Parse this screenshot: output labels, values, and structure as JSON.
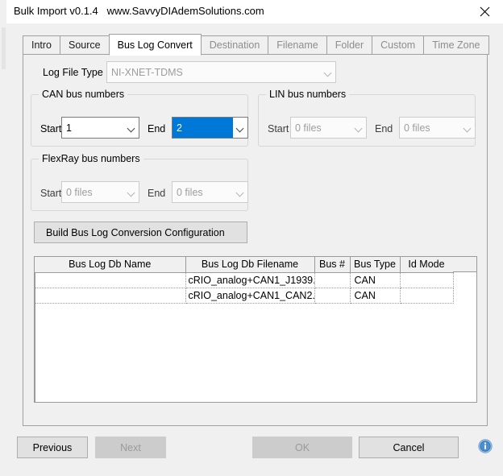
{
  "window": {
    "title": "Bulk Import v0.1.4   www.SavvyDIAdemSolutions.com",
    "close_icon": "close-icon"
  },
  "tabs": [
    {
      "label": "Intro",
      "state": "enabled"
    },
    {
      "label": "Source",
      "state": "enabled"
    },
    {
      "label": "Bus Log Convert",
      "state": "active"
    },
    {
      "label": "Destination",
      "state": "disabled"
    },
    {
      "label": "Filename",
      "state": "disabled"
    },
    {
      "label": "Folder",
      "state": "disabled"
    },
    {
      "label": "Custom",
      "state": "disabled"
    },
    {
      "label": "Time Zone",
      "state": "disabled"
    }
  ],
  "form": {
    "log_file_type_label": "Log File Type",
    "log_file_type_value": "NI-XNET-TDMS",
    "start_label": "Start",
    "end_label": "End",
    "can_group": {
      "title": "CAN bus numbers",
      "start_value": "1",
      "end_value": "2"
    },
    "lin_group": {
      "title": "LIN bus numbers",
      "start_value": "0 files",
      "end_value": "0 files"
    },
    "flexray_group": {
      "title": "FlexRay bus numbers",
      "start_value": "0 files",
      "end_value": "0 files"
    },
    "build_button_label": "Build Bus Log Conversion Configuration"
  },
  "grid": {
    "columns": [
      "Bus Log Db Name",
      "Bus Log Db Filename",
      "Bus #",
      "Bus Type",
      "Id Mode"
    ],
    "rows": [
      {
        "bus_log_db_name": "",
        "bus_log_db_filename": "cRIO_analog+CAN1_J1939....",
        "bus_number": "",
        "bus_type": "CAN",
        "id_mode": ""
      },
      {
        "bus_log_db_name": "",
        "bus_log_db_filename": "cRIO_analog+CAN1_CAN2...",
        "bus_number": "",
        "bus_type": "CAN",
        "id_mode": ""
      }
    ]
  },
  "footer": {
    "previous_label": "Previous",
    "next_label": "Next",
    "ok_label": "OK",
    "cancel_label": "Cancel",
    "info_icon": "info-icon"
  },
  "colors": {
    "accent_blue": "#0078d7",
    "window_bg": "#f0f0f0",
    "button_bg": "#e1e1e1",
    "disabled_text": "#9a9a9a"
  }
}
